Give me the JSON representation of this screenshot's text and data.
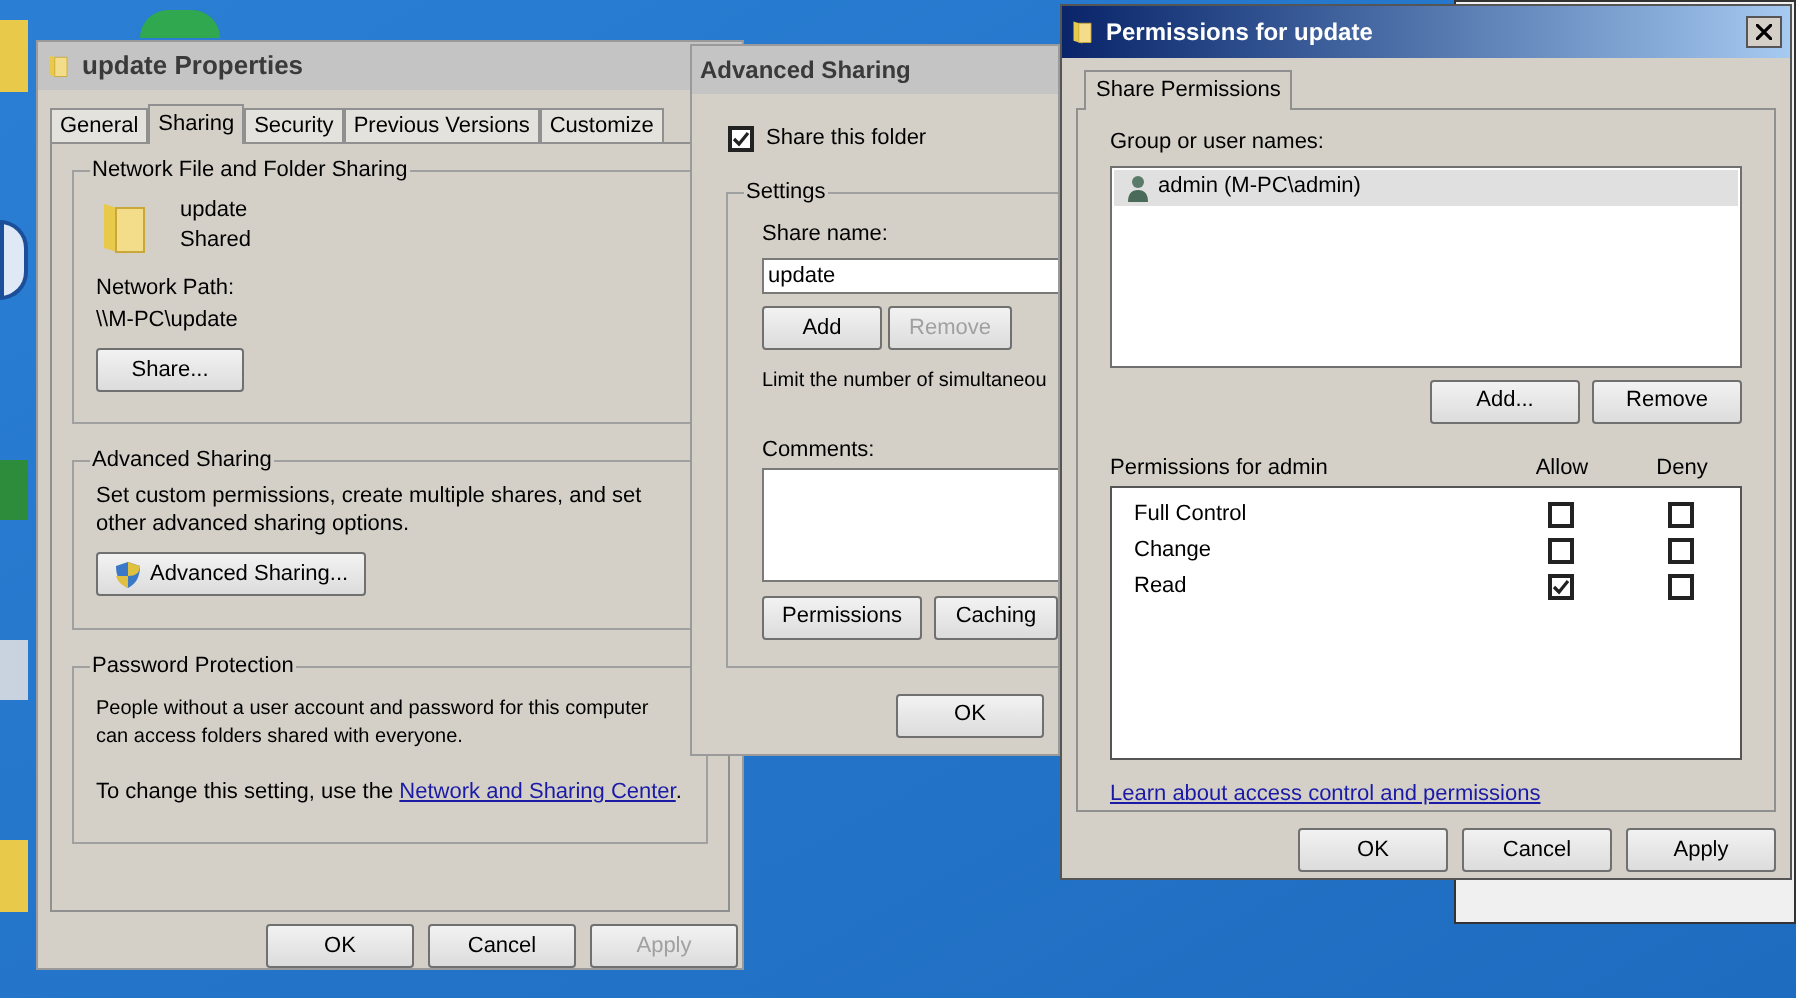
{
  "properties_window": {
    "title": "update Properties",
    "tabs": [
      {
        "label": "General",
        "selected": false
      },
      {
        "label": "Sharing",
        "selected": true
      },
      {
        "label": "Security",
        "selected": false
      },
      {
        "label": "Previous Versions",
        "selected": false
      },
      {
        "label": "Customize",
        "selected": false
      }
    ],
    "network_group": {
      "title": "Network File and Folder Sharing",
      "folder_name": "update",
      "status": "Shared",
      "path_label": "Network Path:",
      "path": "\\\\M-PC\\update",
      "share_button": "Share..."
    },
    "advanced_group": {
      "title": "Advanced Sharing",
      "description": "Set custom permissions, create multiple shares, and set other advanced sharing options.",
      "button": "Advanced Sharing..."
    },
    "password_group": {
      "title": "Password Protection",
      "description": "People without a user account and password for this computer can access folders shared with everyone.",
      "hint": "To change this setting, use the",
      "link": "Network and Sharing Center",
      "hint_end": "."
    },
    "buttons": [
      {
        "label": "OK",
        "disabled": false
      },
      {
        "label": "Cancel",
        "disabled": false
      },
      {
        "label": "Apply",
        "disabled": true
      }
    ]
  },
  "advanced_window": {
    "title": "Advanced Sharing",
    "share_checkbox": {
      "label": "Share this folder",
      "checked": true
    },
    "settings": {
      "title": "Settings",
      "share_name_label": "Share name:",
      "share_name_value": "update",
      "add_button": {
        "label": "Add",
        "disabled": false
      },
      "remove_button": {
        "label": "Remove",
        "disabled": true
      },
      "limit_text": "Limit the number of simultaneou",
      "comments_label": "Comments:",
      "permissions_button": "Permissions",
      "caching_button": "Caching"
    },
    "ok_button": "OK"
  },
  "permissions_window": {
    "title": "Permissions for update",
    "tabs": [
      {
        "label": "Share Permissions",
        "selected": true
      }
    ],
    "group_label": "Group or user names:",
    "users": [
      {
        "name": "admin (M-PC\\admin)",
        "selected": true
      }
    ],
    "add_button": "Add...",
    "remove_button": "Remove",
    "permissions_label": "Permissions for admin",
    "allow_label": "Allow",
    "deny_label": "Deny",
    "permissions": [
      {
        "name": "Full Control",
        "allow": false,
        "deny": false
      },
      {
        "name": "Change",
        "allow": false,
        "deny": false
      },
      {
        "name": "Read",
        "allow": true,
        "deny": false
      }
    ],
    "link": "Learn about access control and permissions",
    "buttons": [
      {
        "label": "OK",
        "disabled": false
      },
      {
        "label": "Cancel",
        "disabled": false
      },
      {
        "label": "Apply",
        "disabled": false
      }
    ]
  }
}
